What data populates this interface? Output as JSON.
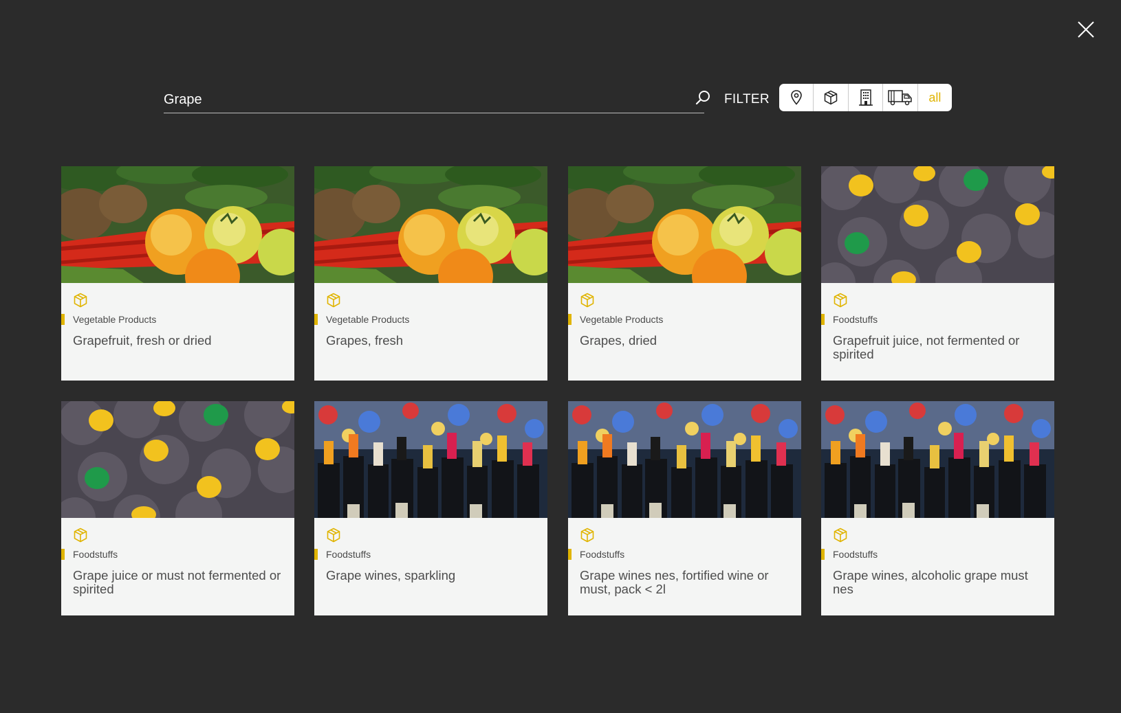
{
  "search": {
    "value": "Grape",
    "search_icon": "search-icon"
  },
  "filter": {
    "label": "FILTER",
    "options": [
      {
        "icon": "location-pin-icon"
      },
      {
        "icon": "package-box-icon"
      },
      {
        "icon": "building-icon"
      },
      {
        "icon": "truck-icon"
      },
      {
        "label": "all"
      }
    ],
    "accent": "#e0b400"
  },
  "close": {
    "icon": "close-icon"
  },
  "cards": [
    {
      "category": "Vegetable Products",
      "title": "Grapefruit, fresh or dried",
      "image": "vegetables",
      "icon": "package-box-icon"
    },
    {
      "category": "Vegetable Products",
      "title": "Grapes, fresh",
      "image": "vegetables",
      "icon": "package-box-icon"
    },
    {
      "category": "Vegetable Products",
      "title": "Grapes, dried",
      "image": "vegetables",
      "icon": "package-box-icon"
    },
    {
      "category": "Foodstuffs",
      "title": "Grapefruit juice, not fermented or spirited",
      "image": "juice-bottles",
      "icon": "package-box-icon"
    },
    {
      "category": "Foodstuffs",
      "title": "Grape juice or must not fermented or spirited",
      "image": "juice-bottles",
      "icon": "package-box-icon"
    },
    {
      "category": "Foodstuffs",
      "title": "Grape wines, sparkling",
      "image": "wine-bottles",
      "icon": "package-box-icon"
    },
    {
      "category": "Foodstuffs",
      "title": "Grape wines nes, fortified wine or must, pack < 2l",
      "image": "wine-bottles",
      "icon": "package-box-icon"
    },
    {
      "category": "Foodstuffs",
      "title": "Grape wines, alcoholic grape must nes",
      "image": "wine-bottles",
      "icon": "package-box-icon"
    }
  ]
}
